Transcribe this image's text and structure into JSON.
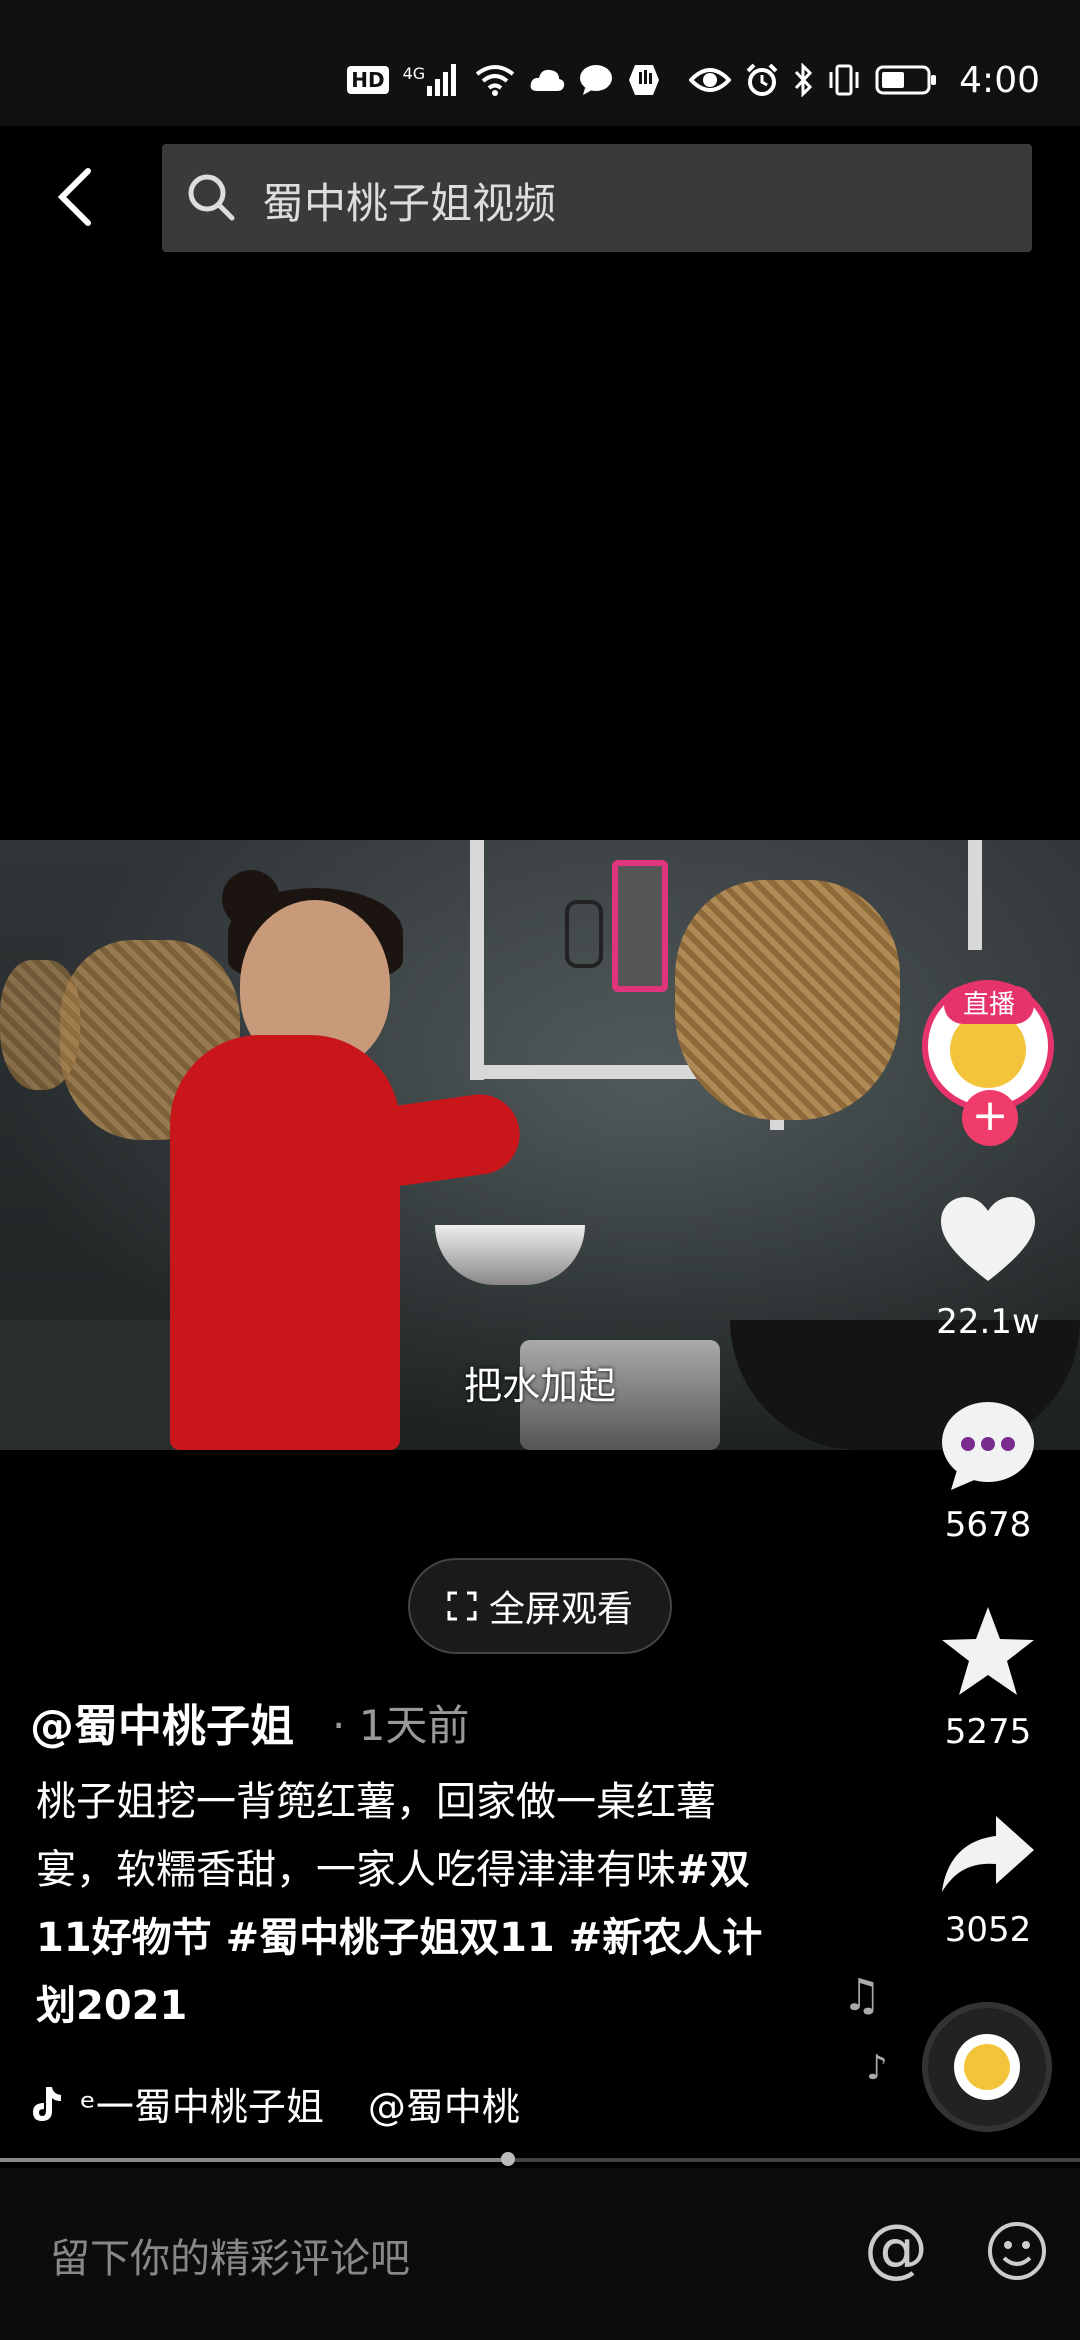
{
  "status_bar": {
    "icons": [
      "hd-icon",
      "4g-signal-icon",
      "wifi-icon",
      "cloud-icon",
      "message-icon",
      "hand-icon",
      "eye-icon",
      "alarm-icon",
      "bluetooth-icon",
      "vibrate-icon",
      "battery-icon"
    ],
    "hd": "HD",
    "network": "4G",
    "time": "4:00"
  },
  "header": {
    "search_text": "蜀中桃子姐视频"
  },
  "video": {
    "subtitle": "把水加起"
  },
  "actions": {
    "live_badge": "直播",
    "follow": "+",
    "likes": "22.1w",
    "comments": "5678",
    "favorites": "5275",
    "shares": "3052"
  },
  "fullscreen": {
    "label": "全屏观看"
  },
  "post": {
    "author": "@蜀中桃子姐",
    "time": "· 1天前",
    "desc_text": "桃子姐挖一背篼红薯，回家做一桌红薯宴，软糯香甜，一家人吃得津津有味",
    "desc_tags": "#双11好物节 #蜀中桃子姐双11 #新农人计划2021",
    "music": "ᵉ一蜀中桃子姐",
    "music_at": "@蜀中桃"
  },
  "progress": {
    "fraction": 0.47
  },
  "comment_bar": {
    "placeholder": "留下你的精彩评论吧"
  },
  "colors": {
    "accent": "#e7336c",
    "background": "#000000",
    "search_bg": "#3a3a3a"
  }
}
